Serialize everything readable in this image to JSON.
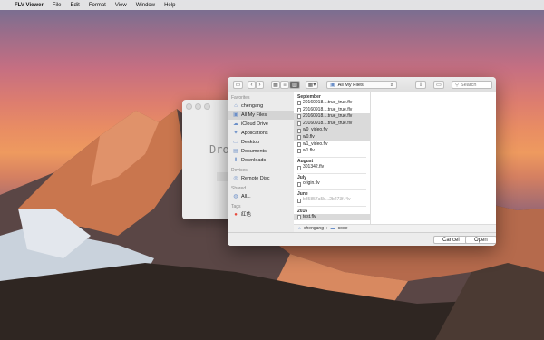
{
  "menubar": {
    "apple_glyph": "",
    "app_name": "FLV Viewer",
    "items": [
      "File",
      "Edit",
      "Format",
      "View",
      "Window",
      "Help"
    ]
  },
  "background_window": {
    "partial_text": "Dro"
  },
  "toolbar": {
    "location": "All My Files",
    "search_placeholder": "Search",
    "icons": [
      "sidebar-toggle-icon",
      "back-icon",
      "forward-icon",
      "icon-view-icon",
      "list-view-icon",
      "column-view-icon",
      "arrange-icon",
      "share-icon",
      "tag-icon",
      "search-icon"
    ]
  },
  "sidebar": {
    "favorites_header": "Favorites",
    "favorites": [
      {
        "label": "chengang",
        "icon": "home-icon",
        "active": false
      },
      {
        "label": "All My Files",
        "icon": "all-files-icon",
        "active": true
      },
      {
        "label": "iCloud Drive",
        "icon": "cloud-icon",
        "active": false
      },
      {
        "label": "Applications",
        "icon": "applications-icon",
        "active": false
      },
      {
        "label": "Desktop",
        "icon": "desktop-icon",
        "active": false
      },
      {
        "label": "Documents",
        "icon": "documents-icon",
        "active": false
      },
      {
        "label": "Downloads",
        "icon": "downloads-icon",
        "active": false
      }
    ],
    "devices_header": "Devices",
    "devices": [
      {
        "label": "Remote Disc",
        "icon": "disc-icon"
      }
    ],
    "shared_header": "Shared",
    "shared": [
      {
        "label": "All...",
        "icon": "network-icon"
      }
    ],
    "tags_header": "Tags",
    "tags": [
      {
        "label": "红色",
        "color": "#e84a3c"
      }
    ]
  },
  "files": {
    "sections": [
      {
        "header": "September",
        "items": [
          {
            "name": "20160918....true_true.flv",
            "selected": false,
            "dim": false
          },
          {
            "name": "20160918....true_true.flv",
            "selected": false,
            "dim": false
          },
          {
            "name": "20160918....true_true.flv",
            "selected": true,
            "dim": false
          },
          {
            "name": "20160918....true_true.flv",
            "selected": true,
            "dim": false
          },
          {
            "name": "w0_video.flv",
            "selected": true,
            "dim": false
          },
          {
            "name": "w0.flv",
            "selected": true,
            "dim": false
          },
          {
            "name": "w1_video.flv",
            "selected": false,
            "dim": false
          },
          {
            "name": "w1.flv",
            "selected": false,
            "dim": false
          }
        ]
      },
      {
        "header": "August",
        "items": [
          {
            "name": "301342.flv",
            "selected": false,
            "dim": false
          }
        ]
      },
      {
        "header": "July",
        "items": [
          {
            "name": "origin.flv",
            "selected": false,
            "dim": false
          }
        ]
      },
      {
        "header": "June",
        "items": [
          {
            "name": "b85857a5b...2b273f.f4v",
            "selected": false,
            "dim": true
          }
        ]
      },
      {
        "header": "2016",
        "items": [
          {
            "name": "test.flv",
            "selected": true,
            "dim": false
          }
        ]
      }
    ]
  },
  "path": {
    "parts": [
      "chengang",
      "code"
    ]
  },
  "buttons": {
    "cancel": "Cancel",
    "open": "Open"
  },
  "colors": {
    "selection": "#dadada",
    "folder_blue": "#6b8fc8",
    "tag_red": "#e84a3c"
  }
}
